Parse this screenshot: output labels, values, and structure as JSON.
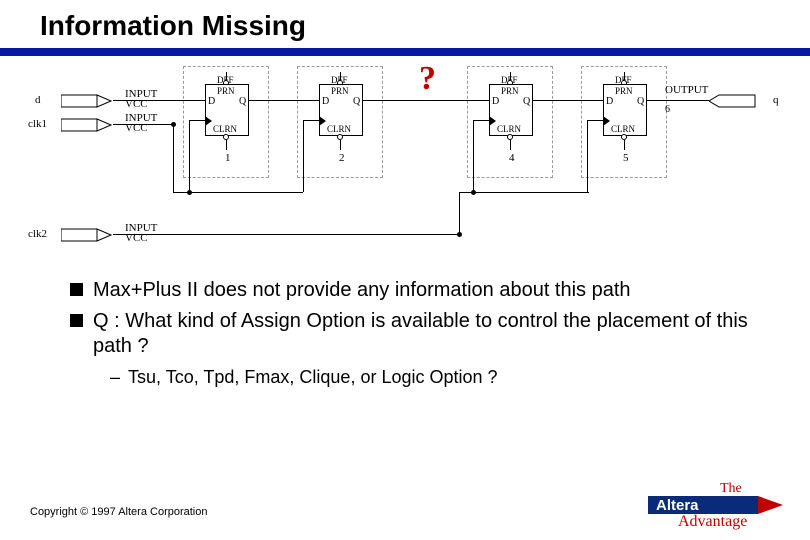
{
  "title": "Information Missing",
  "diagram": {
    "inputs": [
      {
        "name": "d",
        "type": "INPUT",
        "vcc": "VCC"
      },
      {
        "name": "clk1",
        "type": "INPUT",
        "vcc": "VCC"
      },
      {
        "name": "clk2",
        "type": "INPUT",
        "vcc": "VCC"
      }
    ],
    "output": {
      "name": "q",
      "type": "OUTPUT",
      "net": "6"
    },
    "dff": [
      {
        "id": "1",
        "top": "DFF",
        "prn": "PRN",
        "d": "D",
        "q": "Q",
        "clrn": "CLRN"
      },
      {
        "id": "2",
        "top": "DFF",
        "prn": "PRN",
        "d": "D",
        "q": "Q",
        "clrn": "CLRN"
      },
      {
        "id": "4",
        "top": "DFF",
        "prn": "PRN",
        "d": "D",
        "q": "Q",
        "clrn": "CLRN"
      },
      {
        "id": "5",
        "top": "DFF",
        "prn": "PRN",
        "d": "D",
        "q": "Q",
        "clrn": "CLRN"
      }
    ],
    "question_mark": "?"
  },
  "bullets": [
    "Max+Plus II does not provide any information about this path",
    "Q : What kind of Assign Option is available to control the placement of this path ?"
  ],
  "sub_bullet": "Tsu, Tco, Tpd, Fmax, Clique, or Logic Option ?",
  "copyright": "Copyright © 1997 Altera Corporation",
  "logo": {
    "top": "The",
    "mid": "Altera",
    "bot": "Advantage"
  }
}
